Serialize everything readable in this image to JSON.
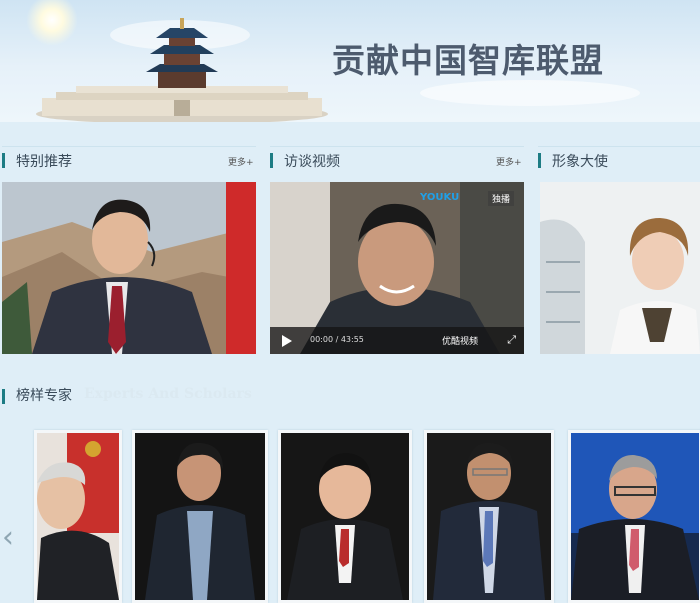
{
  "banner": {
    "title": "贡献中国智库联盟"
  },
  "sections": {
    "featured": {
      "title": "特别推荐",
      "more": "更多+"
    },
    "interviews": {
      "title": "访谈视频",
      "more": "更多+"
    },
    "ambassador": {
      "title": "形象大使"
    },
    "experts": {
      "title": "榜样专家",
      "subtitle": "Experts And Scholars"
    }
  },
  "video": {
    "brand_logo": "YOUKU",
    "badge": "独播",
    "time": "00:00 / 43:55",
    "provider": "优酷视频",
    "fullscreen_icon": "fullscreen-icon",
    "play_icon": "play-icon"
  },
  "carousel": {
    "prev_icon": "chevron-left-icon",
    "prev_glyph": "‹"
  },
  "colors": {
    "accent": "#1d7c84",
    "background": "#dfeef7"
  }
}
